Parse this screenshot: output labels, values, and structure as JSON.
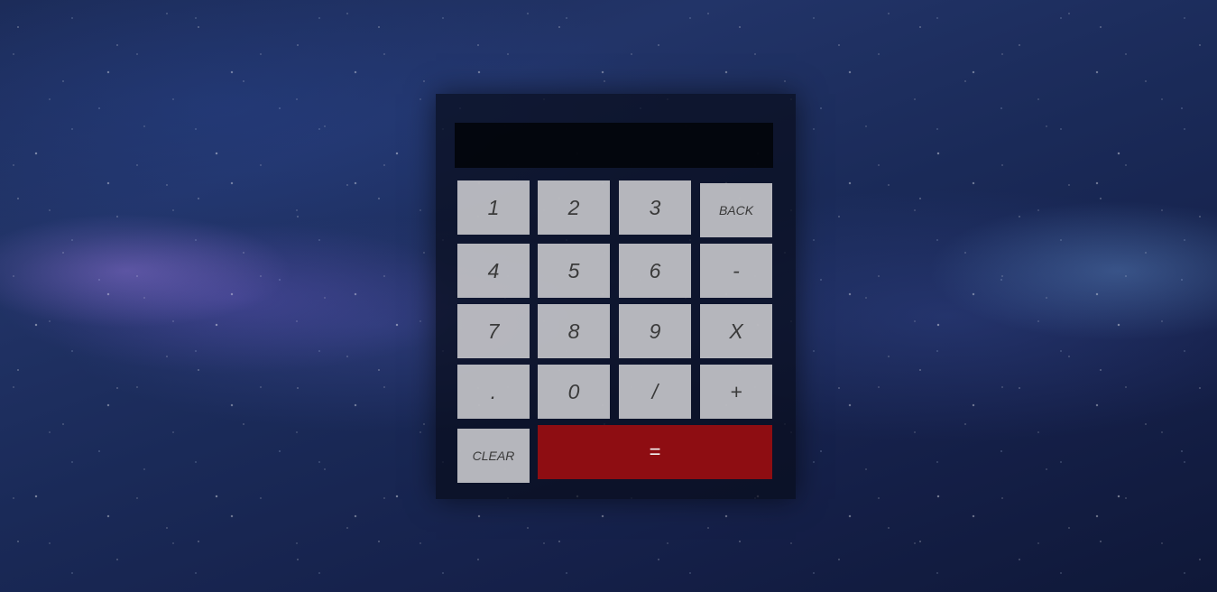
{
  "display": {
    "value": ""
  },
  "keys": {
    "one": "1",
    "two": "2",
    "three": "3",
    "back": "BACK",
    "four": "4",
    "five": "5",
    "six": "6",
    "minus": "-",
    "seven": "7",
    "eight": "8",
    "nine": "9",
    "multiply": "X",
    "decimal": ".",
    "zero": "0",
    "divide": "/",
    "plus": "+",
    "clear": "CLEAR",
    "equals": "="
  },
  "colors": {
    "key_background": "#cdcdd0",
    "equals_background": "#8e0d12",
    "display_background": "#02040a"
  }
}
